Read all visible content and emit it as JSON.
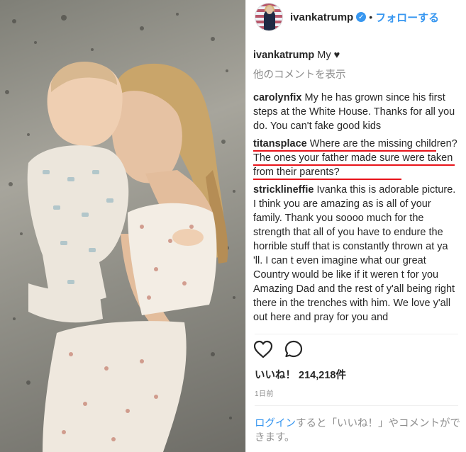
{
  "post": {
    "username": "ivankatrump",
    "separator": "•",
    "follow_label": "フォローする",
    "verified_icon": "verified-check-icon",
    "caption_text": "My",
    "caption_emoji": "♥",
    "view_more_comments": "他のコメントを表示"
  },
  "comments": [
    {
      "user": "carolynfix",
      "text": "My he has grown since his first steps at the White House. Thanks for all you do. You can't fake good kids"
    },
    {
      "user": "titansplace",
      "text": "Where are the missing children? The ones your father made sure were taken from their parents?"
    },
    {
      "user": "stricklineffie",
      "text": "Ivanka this is adorable picture. I think you are amazing as is all of your family. Thank you soooo much for the strength that all of you have to endure the horrible stuff that is constantly thrown at ya 'll. I can t even imagine what our great Country would be like if it weren t for you Amazing Dad and the rest of y'all being right there in the trenches with him. We love y'all out here and pray for you and"
    }
  ],
  "actions": {
    "like_icon": "heart-outline-icon",
    "comment_icon": "comment-bubble-icon"
  },
  "likes_label": "いいね！",
  "likes_count": "214,218件",
  "time_ago": "1日前",
  "login_prompt": {
    "link": "ログイン",
    "text": "すると「いいね！」やコメントができます。"
  },
  "colors": {
    "link_blue": "#3897f0",
    "highlight_red": "#e8141b",
    "muted_gray": "#8e8e8e"
  }
}
